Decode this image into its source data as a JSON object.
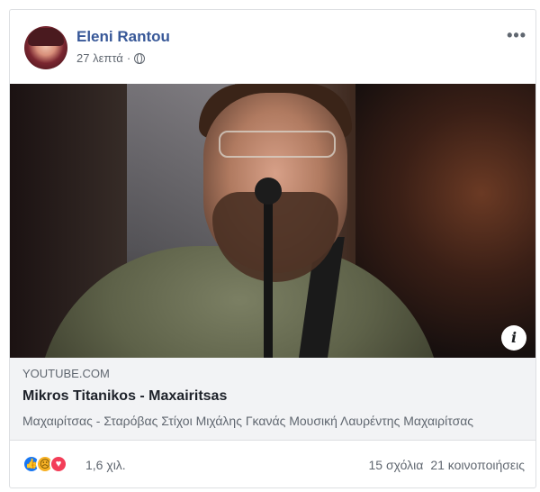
{
  "post": {
    "author": "Eleni Rantou",
    "time": "27 λεπτά",
    "separator": "·"
  },
  "link": {
    "domain": "YOUTUBE.COM",
    "title": "Mikros Titanikos - Maxairitsas",
    "description": "Μαχαιρίτσας - Σταρόβας Στίχοι Μιχάλης Γκανάς Μουσική Λαυρέντης Μαχαιρίτσας"
  },
  "reactions": {
    "count": "1,6 χιλ.",
    "icons": [
      "like-icon",
      "sad-icon",
      "love-icon"
    ],
    "comments": "15 σχόλια",
    "shares": "21 κοινοποιήσεις"
  },
  "colors": {
    "author": "#385898",
    "like": "#1877f2",
    "love": "#f33e58",
    "sad": "#f7b125"
  }
}
